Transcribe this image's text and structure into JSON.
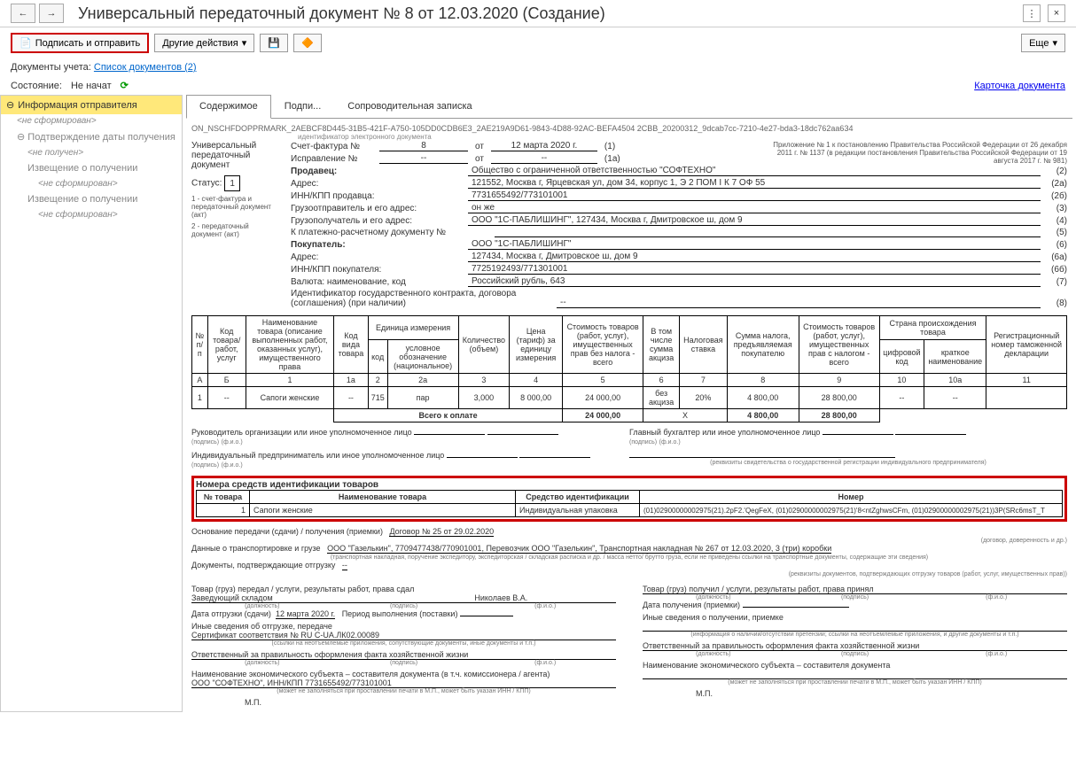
{
  "header": {
    "title": "Универсальный передаточный документ № 8 от 12.03.2020 (Создание)"
  },
  "toolbar": {
    "sign_send": "Подписать и отправить",
    "other_actions": "Другие действия",
    "more": "Еще"
  },
  "doc_links": {
    "label": "Документы учета:",
    "link": "Список документов (2)"
  },
  "state": {
    "label": "Состояние:",
    "value": "Не начат"
  },
  "card_link": "Карточка документа",
  "sidebar": {
    "info_sender": "Информация отправителя",
    "not_formed": "<не сформирован>",
    "confirm_date": "Подтверждение даты получения",
    "not_received": "<не получен>",
    "notice_receipt": "Извещение о получении"
  },
  "tabs": {
    "content": "Содержимое",
    "signatures": "Подпи...",
    "cover_note": "Сопроводительная записка"
  },
  "doc": {
    "id_line": "ON_NSCHFDOPPRMARK_2AEBCF8D445-31B5-421F-A750-105DD0CDB6E3_2AE219A9D61-9843-4D88-92AC-BEFA4504 2CBB_20200312_9dcab7cc-7210-4e27-bda3-18dc762aa634",
    "id_caption": "идентификатор электронного документа",
    "upd_title1": "Универсальный",
    "upd_title2": "передаточный",
    "upd_title3": "документ",
    "status_label": "Статус:",
    "status_value": "1",
    "legend1": "1 - счет-фактура и передаточный документ (акт)",
    "legend2": "2 - передаточный документ (акт)",
    "annex": "Приложение № 1 к постановлению Правительства Российской Федерации от 26 декабря 2011 г. № 1137 (в редакции постановления Правительства Российской Федерации от 19 августа 2017 г. № 981)",
    "invoice_label": "Счет-фактура №",
    "invoice_no": "8",
    "invoice_date_label": "от",
    "invoice_date": "12 марта 2020 г.",
    "invoice_suffix": "(1)",
    "correction_label": "Исправление №",
    "correction_no": "--",
    "correction_date": "--",
    "correction_suffix": "(1а)",
    "seller_label": "Продавец:",
    "seller": "Общество с ограниченной ответственностью \"СОФТЕХНО\"",
    "seller_num": "(2)",
    "address_label": "Адрес:",
    "address": "121552, Москва г, Ярцевская ул, дом 34, корпус 1, Э 2 ПОМ I К 7 ОФ 55",
    "address_num": "(2а)",
    "inn_label": "ИНН/КПП продавца:",
    "inn": "7731655492/773101001",
    "inn_num": "(2б)",
    "shipper_label": "Грузоотправитель и его адрес:",
    "shipper": "он же",
    "shipper_num": "(3)",
    "consignee_label": "Грузополучатель и его адрес:",
    "consignee": "ООО \"1С-ПАБЛИШИНГ\", 127434, Москва г, Дмитровское ш, дом 9",
    "consignee_num": "(4)",
    "payment_label": "К платежно-расчетному документу №",
    "payment": "",
    "payment_num": "(5)",
    "buyer_label": "Покупатель:",
    "buyer": "ООО \"1С-ПАБЛИШИНГ\"",
    "buyer_num": "(6)",
    "buyer_addr_label": "Адрес:",
    "buyer_addr": "127434, Москва г, Дмитровское ш, дом 9",
    "buyer_addr_num": "(6а)",
    "buyer_inn_label": "ИНН/КПП покупателя:",
    "buyer_inn": "7725192493/771301001",
    "buyer_inn_num": "(6б)",
    "currency_label": "Валюта: наименование, код",
    "currency": "Российский рубль, 643",
    "currency_num": "(7)",
    "contract_id_label": "Идентификатор государственного контракта, договора (соглашения) (при наличии)",
    "contract_id": "--",
    "contract_id_num": "(8)"
  },
  "goods_header": {
    "h_np": "№ п/п",
    "h_code": "Код товара/ работ, услуг",
    "h_name": "Наименование товара (описание выполненных работ, оказанных услуг), имущественного права",
    "h_kind": "Код вида товара",
    "h_unit": "Единица измерения",
    "h_unit_code": "код",
    "h_unit_name": "условное обозначение (национальное)",
    "h_qty": "Количество (объем)",
    "h_price": "Цена (тариф) за единицу измерения",
    "h_cost_notax": "Стоимость товаров (работ, услуг), имущественных прав без налога - всего",
    "h_excise": "В том числе сумма акциза",
    "h_rate": "Налоговая ставка",
    "h_tax_sum": "Сумма налога, предъявляемая покупателю",
    "h_cost_tax": "Стоимость товаров (работ, услуг), имущественных прав с налогом - всего",
    "h_origin": "Страна происхождения товара",
    "h_origin_code": "цифровой код",
    "h_origin_name": "краткое наименование",
    "h_decl": "Регистрационный номер таможенной декларации",
    "cA": "А",
    "cB": "Б",
    "c1": "1",
    "c1a": "1а",
    "c2": "2",
    "c2a": "2а",
    "c3": "3",
    "c4": "4",
    "c5": "5",
    "c6": "6",
    "c7": "7",
    "c8": "8",
    "c9": "9",
    "c10": "10",
    "c10a": "10а",
    "c11": "11"
  },
  "goods_row": {
    "np": "1",
    "code": "--",
    "name": "Сапоги женские",
    "kind": "--",
    "unit_code": "715",
    "unit_name": "пар",
    "qty": "3,000",
    "price": "8 000,00",
    "cost_notax": "24 000,00",
    "excise": "без акциза",
    "rate": "20%",
    "tax_sum": "4 800,00",
    "cost_tax": "28 800,00",
    "origin_code": "--",
    "origin_name": "--",
    "decl": ""
  },
  "goods_total": {
    "label": "Всего к оплате",
    "cost_notax": "24 000,00",
    "x": "Х",
    "tax_sum": "4 800,00",
    "cost_tax": "28 800,00"
  },
  "sig": {
    "head_org": "Руководитель организации или иное уполномоченное лицо",
    "chief_acc": "Главный бухгалтер или иное уполномоченное лицо",
    "ip": "Индивидуальный предприниматель или иное уполномоченное лицо",
    "cap_sign": "(подпись)",
    "cap_fio": "(ф.и.о.)",
    "cap_rekv": "(реквизиты свидетельства о государственной регистрации индивидуального предпринимателя)"
  },
  "ident": {
    "title": "Номера средств идентификации товаров",
    "h_no": "№ товара",
    "h_name": "Наименование товара",
    "h_means": "Средство идентификации",
    "h_number": "Номер",
    "row_no": "1",
    "row_name": "Сапоги женские",
    "row_means": "Индивидуальная упаковка",
    "row_number": "(01)02900000002975(21).2pF2.'QegFeX, (01)02900000002975(21)'8<ntZghwsCFm, (01)02900000002975(21))3P(SRc6msT_T"
  },
  "bottom": {
    "basis_label": "Основание передачи (сдачи) / получения (приемки)",
    "basis_value": "Договор № 25 от 29.02.2020",
    "basis_cap": "(договор, доверенность и др.)",
    "transport_label": "Данные о транспортировке и грузе",
    "transport_value": "ООО \"Газелькин\", 7709477438/770901001, Перевозчик ООО \"Газелькин\", Транспортная накладная № 267 от 12.03.2020, 3 (три) коробки",
    "transport_cap": "(транспортная накладная, поручение экспедитору, экспедиторская / складская расписка и др. / масса нетто/ брутто груза, если не приведены ссылки на транспортные документы, содержащие эти сведения)",
    "ship_docs_label": "Документы, подтверждающие отгрузку",
    "ship_docs_value": "--",
    "ship_docs_cap": "(реквизиты документов, подтверждающих отгрузку товаров (работ, услуг, имущественных прав))"
  },
  "left_col": {
    "l1": "Товар (груз) передал / услуги, результаты работ, права сдал",
    "role": "Заведующий складом",
    "person": "Николаев В.А.",
    "cap_role": "(должность)",
    "cap_sign": "(подпись)",
    "cap_fio": "(ф.и.о.)",
    "date_label": "Дата отгрузки (сдачи)",
    "date_value": "12 марта 2020 г.",
    "period_label": "Период выполнения (поставки)",
    "other_label": "Иные сведения об отгрузке, передаче",
    "cert": "Сертификат соответствия № RU C-UA.ЛК02.00089",
    "cert_cap": "(ссылки на неотъемлемые приложения, сопутствующие документы, иные документы и т.п.)",
    "resp_label": "Ответственный за правильность оформления факта хозяйственной жизни",
    "entity_label": "Наименование экономического субъекта – составителя документа (в т.ч. комиссионера / агента)",
    "entity_value": "ООО \"СОФТЕХНО\", ИНН/КПП 7731655492/773101001",
    "entity_cap": "(может не заполняться при проставлении печати в М.П., может быть указан ИНН / КПП)",
    "mp": "М.П."
  },
  "right_col": {
    "l1": "Товар (груз) получил / услуги, результаты работ, права принял",
    "date_label": "Дата получения (приемки)",
    "other_label": "Иные сведения о получении, приемке",
    "other_cap": "(информация о наличии/отсутствии претензии; ссылки на неотъемлемые приложения, и другие документы и т.п.)",
    "resp_label": "Ответственный за правильность оформления факта хозяйственной жизни",
    "entity_label": "Наименование экономического субъекта – составителя документа",
    "entity_cap": "(может не заполняться при проставлении печати в М.П., может быть указан ИНН / КПП)",
    "mp": "М.П."
  }
}
